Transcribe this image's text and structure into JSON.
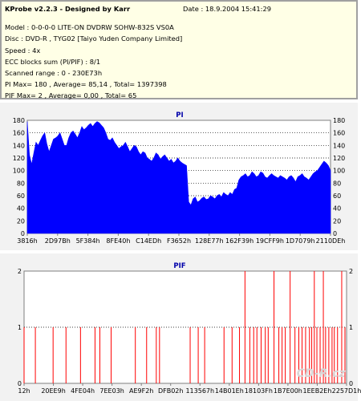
{
  "info": {
    "title": "KProbe v2.2.3 - Designed by Karr",
    "date": "Date : 18.9.2004 15:41:29",
    "lines": [
      "Model : 0-0-0-0 LITE-ON DVDRW SOHW-832S  VS0A",
      "Disc : DVD-R , TYG02 [Taiyo Yuden Company Limited]",
      "Speed : 4x",
      "ECC blocks sum (PI/PIF) : 8/1",
      "Scanned range : 0 - 230E73h",
      "PI Max= 180 , Average= 85,14 , Total= 1397398",
      "PIF Max= 2 , Average= 0,00 , Total= 65"
    ]
  },
  "colors": {
    "pi_fill": "#0000ff",
    "pif_line": "#ff0000",
    "grid": "#000000",
    "axis": "#7f7f7f",
    "title": "#0000aa",
    "panel_bg": "#f2f2f2",
    "plot_bg": "#ffffff",
    "info_bg": "#ffffe6"
  },
  "watermark": "CD-R.cz",
  "chart_data": [
    {
      "type": "area",
      "title": "PI",
      "ylim": [
        0,
        180
      ],
      "yticks": [
        0,
        20,
        40,
        60,
        80,
        100,
        120,
        140,
        160,
        180
      ],
      "xticks": [
        "3816h",
        "2D97Bh",
        "5F384h",
        "8FE40h",
        "C14EDh",
        "F3652h",
        "128E77h",
        "162F39h",
        "19CFF9h",
        "1D7079h",
        "2110DEh"
      ],
      "grid": true,
      "series": [
        {
          "values": [
            178,
            125,
            110,
            128,
            145,
            140,
            148,
            155,
            160,
            142,
            130,
            140,
            150,
            152,
            155,
            160,
            150,
            140,
            140,
            152,
            160,
            163,
            158,
            152,
            160,
            170,
            165,
            168,
            172,
            175,
            170,
            175,
            178,
            176,
            172,
            168,
            160,
            150,
            148,
            152,
            145,
            140,
            135,
            138,
            140,
            145,
            138,
            130,
            135,
            140,
            138,
            130,
            125,
            130,
            128,
            120,
            118,
            115,
            120,
            128,
            125,
            118,
            122,
            125,
            120,
            115,
            118,
            112,
            115,
            120,
            115,
            112,
            110,
            108,
            50,
            45,
            55,
            58,
            50,
            52,
            56,
            58,
            54,
            55,
            60,
            58,
            55,
            60,
            62,
            58,
            65,
            62,
            60,
            65,
            62,
            70,
            72,
            85,
            90,
            92,
            95,
            90,
            92,
            98,
            95,
            90,
            92,
            98,
            96,
            90,
            88,
            92,
            95,
            92,
            90,
            88,
            92,
            90,
            88,
            85,
            90,
            92,
            88,
            82,
            90,
            92,
            95,
            90,
            88,
            85,
            90,
            95,
            98,
            100,
            105,
            110,
            115,
            112,
            108,
            100
          ]
        }
      ]
    },
    {
      "type": "bar",
      "title": "PIF",
      "ylim": [
        0,
        2
      ],
      "yticks": [
        0,
        1,
        2
      ],
      "xticks": [
        "12h",
        "20EE9h",
        "4FE04h",
        "7EE03h",
        "AE9F2h",
        "DFB02h",
        "113567h",
        "14B01Eh",
        "18103Fh",
        "1B7E00h",
        "1EEB2Eh",
        "2257D1h"
      ],
      "grid": true,
      "x": [
        0.0,
        0.035,
        0.09,
        0.13,
        0.175,
        0.22,
        0.235,
        0.27,
        0.345,
        0.38,
        0.41,
        0.42,
        0.515,
        0.54,
        0.56,
        0.62,
        0.645,
        0.668,
        0.685,
        0.7,
        0.712,
        0.722,
        0.735,
        0.748,
        0.757,
        0.775,
        0.79,
        0.8,
        0.81,
        0.825,
        0.84,
        0.852,
        0.862,
        0.873,
        0.885,
        0.892,
        0.9,
        0.908,
        0.918,
        0.928,
        0.935,
        0.945,
        0.955,
        0.962,
        0.972,
        0.985,
        0.995
      ],
      "values": [
        1,
        1,
        1,
        1,
        1,
        1,
        1,
        1,
        1,
        1,
        1,
        1,
        1,
        1,
        1,
        1,
        1,
        1,
        2,
        1,
        1,
        1,
        1,
        1,
        1,
        2,
        1,
        1,
        1,
        2,
        1,
        1,
        1,
        1,
        1,
        1,
        2,
        1,
        1,
        2,
        1,
        1,
        1,
        1,
        1,
        2,
        1
      ]
    }
  ]
}
